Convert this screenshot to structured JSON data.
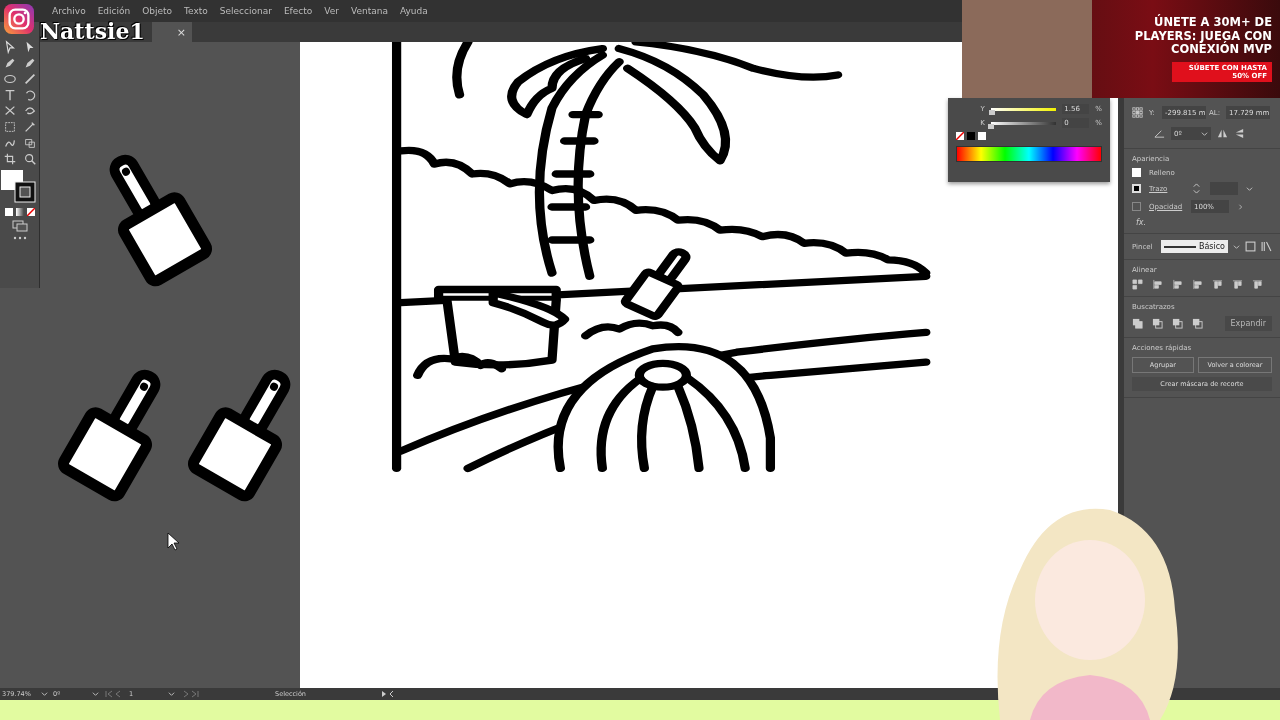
{
  "menu": [
    "Archivo",
    "Edición",
    "Objeto",
    "Texto",
    "Seleccionar",
    "Efecto",
    "Ver",
    "Ventana",
    "Ayuda"
  ],
  "stream_overlay": {
    "name": "Nattsie1"
  },
  "document_tab": {
    "close": "×"
  },
  "color_panel": {
    "sliders": [
      {
        "label": "Y",
        "level": 0.0156,
        "value": "1.56",
        "unit": "%"
      },
      {
        "label": "K",
        "level": 0,
        "value": "0",
        "unit": "%"
      }
    ]
  },
  "ad": {
    "headline": "ÚNETE A 30M+ DE PLAYERS: JUEGA CON CONEXIÓN MVP",
    "cta": "SÚBETE CON HASTA 50% OFF"
  },
  "transform": {
    "y_label": "Y:",
    "y_value": "-299.815 m",
    "height_label": "AL:",
    "height_value": "17.729 mm",
    "angle": "0º"
  },
  "appearance": {
    "title": "Apariencia",
    "fill_label": "Relleno",
    "stroke_label": "Trazo",
    "opacity_label": "Opacidad",
    "opacity_value": "100%",
    "fx": "fx."
  },
  "brush": {
    "label": "Pincel",
    "value": "Básico"
  },
  "align": {
    "title": "Alinear"
  },
  "pathfinder": {
    "title": "Buscatrazos",
    "button": {
      "label": "Expandir",
      "disabled": true
    }
  },
  "quick_actions": {
    "title": "Acciones rápidas",
    "buttons": [
      "Agrupar",
      "Volver a colorear",
      "Crear máscara de recorte"
    ]
  },
  "status_bar": {
    "zoom": "379.74%",
    "rotation": "0º",
    "artboard": "1",
    "tool": "Selección"
  }
}
